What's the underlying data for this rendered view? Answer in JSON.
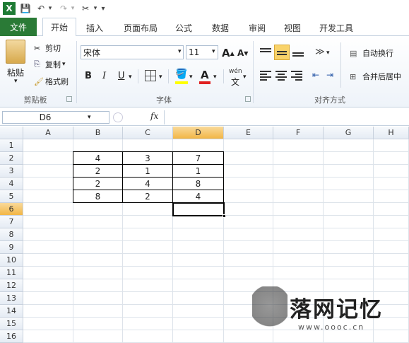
{
  "qat": {
    "excel_icon": "X",
    "save": "💾",
    "undo": "↶",
    "redo": "↷",
    "tools": "✂",
    "more": "▾"
  },
  "menu": {
    "tabs": [
      "文件",
      "开始",
      "插入",
      "页面布局",
      "公式",
      "数据",
      "审阅",
      "视图",
      "开发工具"
    ],
    "active": "开始"
  },
  "ribbon": {
    "clipboard": {
      "paste": "粘贴",
      "cut": "剪切",
      "copy": "复制",
      "painter": "格式刷",
      "label": "剪贴板"
    },
    "font": {
      "name": "宋体",
      "size": "11",
      "grow": "A",
      "shrink": "A",
      "bold": "B",
      "italic": "I",
      "underline": "U",
      "label": "字体",
      "wen": "wén"
    },
    "align": {
      "wrap": "自动换行",
      "merge": "合并后居中",
      "label": "对齐方式"
    }
  },
  "formula_bar": {
    "namebox": "D6",
    "fx": "fx",
    "content": ""
  },
  "sheet": {
    "columns": [
      "A",
      "B",
      "C",
      "D",
      "E",
      "F",
      "G",
      "H"
    ],
    "rows": [
      "1",
      "2",
      "3",
      "4",
      "5",
      "6",
      "7",
      "8",
      "9",
      "10",
      "11",
      "12",
      "13",
      "14",
      "15",
      "16"
    ],
    "selected_col": "D",
    "selected_row": "6",
    "values": {
      "r2": [
        "4",
        "3",
        "7"
      ],
      "r3": [
        "2",
        "1",
        "1"
      ],
      "r4": [
        "2",
        "4",
        "8"
      ],
      "r5": [
        "8",
        "2",
        "4"
      ]
    }
  },
  "watermark": {
    "title": "落网记忆",
    "url": "www.oooc.cn"
  },
  "colors": {
    "file_tab": "#2a7a36",
    "selected_header": "#f2b646"
  }
}
